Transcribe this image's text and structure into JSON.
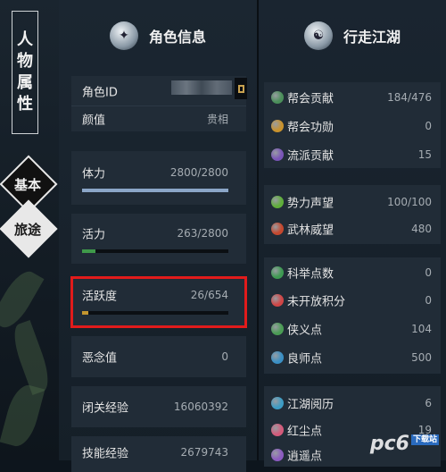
{
  "sidebar": {
    "title_chars": [
      "人",
      "物",
      "属",
      "性"
    ],
    "tabs": [
      {
        "label": "基本"
      },
      {
        "label": "旅途"
      }
    ]
  },
  "char_panel": {
    "title": "角色信息",
    "rows": [
      {
        "label": "角色ID",
        "value": ""
      },
      {
        "label": "颜值",
        "value": "贵相"
      },
      {
        "label": "体力",
        "value": "2800/2800",
        "progress": 1.0,
        "bar_color": "#8ba6c7"
      },
      {
        "label": "活力",
        "value": "263/2800",
        "progress": 0.094,
        "bar_color": "#3f9a4a"
      },
      {
        "label": "活跃度",
        "value": "26/654",
        "progress": 0.04,
        "bar_color": "#c3962f"
      },
      {
        "label": "恶念值",
        "value": "0"
      },
      {
        "label": "闭关经验",
        "value": "16060392"
      },
      {
        "label": "技能经验",
        "value": "2679743"
      }
    ]
  },
  "journey_panel": {
    "title": "行走江湖",
    "groups": [
      [
        {
          "label": "帮会贡献",
          "value": "184/476",
          "icon": "guild-contribution-icon",
          "color": "#4b8f5a"
        },
        {
          "label": "帮会功勋",
          "value": "0",
          "icon": "guild-merit-icon",
          "color": "#c9922d"
        },
        {
          "label": "流派贡献",
          "value": "15",
          "icon": "school-contribution-icon",
          "color": "#7a55b8"
        }
      ],
      [
        {
          "label": "势力声望",
          "value": "100/100",
          "icon": "faction-reputation-icon",
          "color": "#5fae3a"
        },
        {
          "label": "武林威望",
          "value": "480",
          "icon": "martial-prestige-icon",
          "color": "#c5482e"
        }
      ],
      [
        {
          "label": "科举点数",
          "value": "0",
          "icon": "exam-points-icon",
          "color": "#3e9a52"
        },
        {
          "label": "未开放积分",
          "value": "0",
          "icon": "locked-points-icon",
          "color": "#d04646"
        },
        {
          "label": "侠义点",
          "value": "104",
          "icon": "chivalry-icon",
          "color": "#4a9c54"
        },
        {
          "label": "良师点",
          "value": "500",
          "icon": "mentor-icon",
          "color": "#3a8fc4"
        }
      ],
      [
        {
          "label": "江湖阅历",
          "value": "6",
          "icon": "experience-icon",
          "color": "#3d9cc4"
        },
        {
          "label": "红尘点",
          "value": "19",
          "icon": "red-dust-icon",
          "color": "#d45a7a"
        },
        {
          "label": "逍遥点",
          "value": "",
          "icon": "freedom-icon",
          "color": "#8c5bc0"
        }
      ]
    ]
  },
  "watermark": {
    "text": "pc6",
    "badge": "下载站"
  }
}
